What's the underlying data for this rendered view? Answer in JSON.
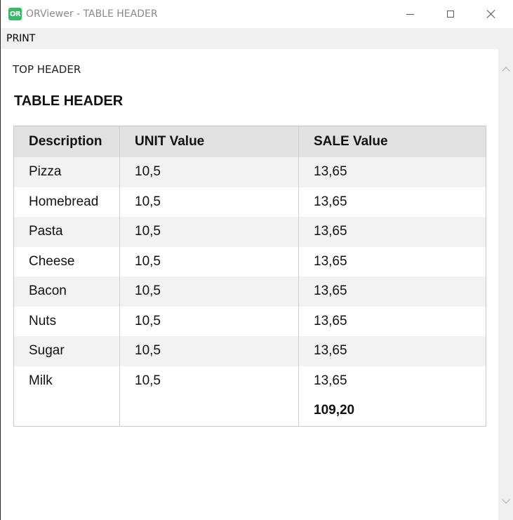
{
  "window": {
    "app_icon_text": "OR",
    "title": "ORViewer - TABLE HEADER"
  },
  "menu": {
    "print_label": "PRINT"
  },
  "report": {
    "top_header": "TOP HEADER",
    "table_title": "TABLE HEADER",
    "columns": [
      "Description",
      "UNIT Value",
      "SALE Value"
    ],
    "rows": [
      [
        "Pizza",
        "10,5",
        "13,65"
      ],
      [
        "Homebread",
        "10,5",
        "13,65"
      ],
      [
        "Pasta",
        "10,5",
        "13,65"
      ],
      [
        "Cheese",
        "10,5",
        "13,65"
      ],
      [
        "Bacon",
        "10,5",
        "13,65"
      ],
      [
        "Nuts",
        "10,5",
        "13,65"
      ],
      [
        "Sugar",
        "10,5",
        "13,65"
      ],
      [
        "Milk",
        "10,5",
        "13,65"
      ]
    ],
    "total": "109,20"
  },
  "icons": {
    "app": "orviewer-app-icon",
    "minimize": "minimize-icon",
    "maximize": "maximize-icon",
    "close": "close-icon",
    "scroll_up": "chevron-up-icon",
    "scroll_down": "chevron-down-icon"
  },
  "colors": {
    "app_icon": "#3ab86a",
    "table_header_bg": "#e1e1e1",
    "odd_row_bg": "#f2f2f2",
    "menubar_bg": "#f0f0f0"
  }
}
